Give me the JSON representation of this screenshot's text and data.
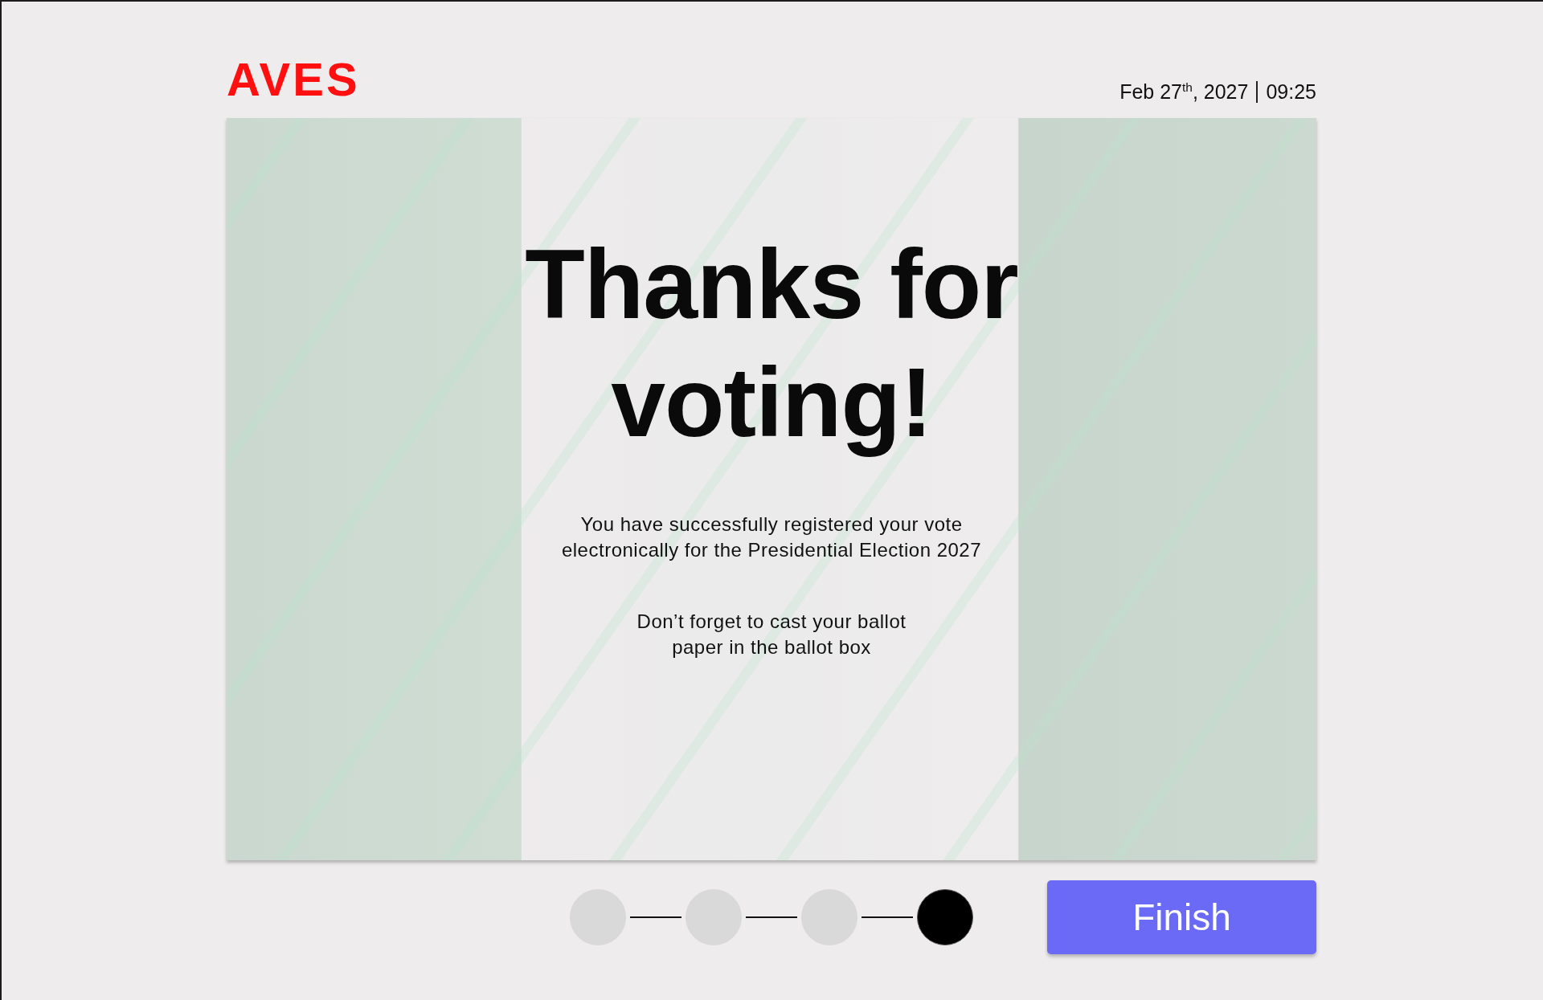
{
  "header": {
    "logo": "AVES",
    "date": "Feb 27$^{th}$, 2027",
    "time": "09:25"
  },
  "card": {
    "heading": "Thanks for voting!",
    "message": "You have successfully registered your vote electronically for the Presidential Election 2027",
    "reminder": "Don’t forget to cast your ballot paper in the ballot box"
  },
  "stepper": {
    "steps": [
      {
        "current": false
      },
      {
        "current": false
      },
      {
        "current": false
      },
      {
        "current": true
      }
    ]
  },
  "finish_button": "Finish"
}
